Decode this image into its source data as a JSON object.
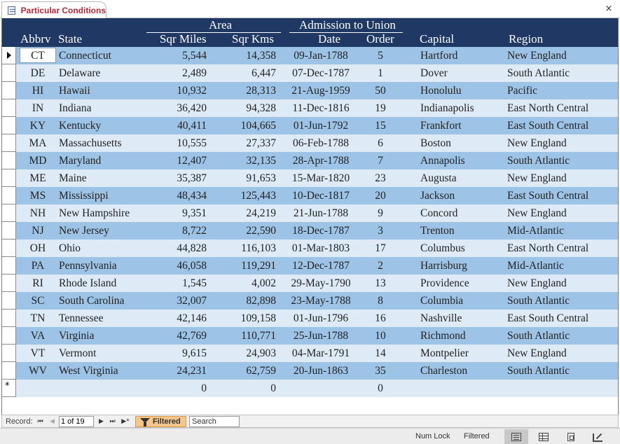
{
  "tab": {
    "title": "Particular Conditions",
    "close_glyph": "×"
  },
  "header": {
    "groups": {
      "area": "Area",
      "admission": "Admission to Union"
    },
    "columns": {
      "abbrv": "Abbrv",
      "state": "State",
      "sqr_miles": "Sqr Miles",
      "sqr_kms": "Sqr Kms",
      "date": "Date",
      "order": "Order",
      "capital": "Capital",
      "region": "Region"
    }
  },
  "records": [
    {
      "abbr": "CT",
      "state": "Connecticut",
      "miles": "5,544",
      "kms": "14,358",
      "date": "09-Jan-1788",
      "order": "5",
      "capital": "Hartford",
      "region": "New England"
    },
    {
      "abbr": "DE",
      "state": "Delaware",
      "miles": "2,489",
      "kms": "6,447",
      "date": "07-Dec-1787",
      "order": "1",
      "capital": "Dover",
      "region": "South Atlantic"
    },
    {
      "abbr": "HI",
      "state": "Hawaii",
      "miles": "10,932",
      "kms": "28,313",
      "date": "21-Aug-1959",
      "order": "50",
      "capital": "Honolulu",
      "region": "Pacific"
    },
    {
      "abbr": "IN",
      "state": "Indiana",
      "miles": "36,420",
      "kms": "94,328",
      "date": "11-Dec-1816",
      "order": "19",
      "capital": "Indianapolis",
      "region": "East North Central"
    },
    {
      "abbr": "KY",
      "state": "Kentucky",
      "miles": "40,411",
      "kms": "104,665",
      "date": "01-Jun-1792",
      "order": "15",
      "capital": "Frankfort",
      "region": "East South Central"
    },
    {
      "abbr": "MA",
      "state": "Massachusetts",
      "miles": "10,555",
      "kms": "27,337",
      "date": "06-Feb-1788",
      "order": "6",
      "capital": "Boston",
      "region": "New England"
    },
    {
      "abbr": "MD",
      "state": "Maryland",
      "miles": "12,407",
      "kms": "32,135",
      "date": "28-Apr-1788",
      "order": "7",
      "capital": "Annapolis",
      "region": "South Atlantic"
    },
    {
      "abbr": "ME",
      "state": "Maine",
      "miles": "35,387",
      "kms": "91,653",
      "date": "15-Mar-1820",
      "order": "23",
      "capital": "Augusta",
      "region": "New England"
    },
    {
      "abbr": "MS",
      "state": "Mississippi",
      "miles": "48,434",
      "kms": "125,443",
      "date": "10-Dec-1817",
      "order": "20",
      "capital": "Jackson",
      "region": "East South Central"
    },
    {
      "abbr": "NH",
      "state": "New Hampshire",
      "miles": "9,351",
      "kms": "24,219",
      "date": "21-Jun-1788",
      "order": "9",
      "capital": "Concord",
      "region": "New England"
    },
    {
      "abbr": "NJ",
      "state": "New Jersey",
      "miles": "8,722",
      "kms": "22,590",
      "date": "18-Dec-1787",
      "order": "3",
      "capital": "Trenton",
      "region": "Mid-Atlantic"
    },
    {
      "abbr": "OH",
      "state": "Ohio",
      "miles": "44,828",
      "kms": "116,103",
      "date": "01-Mar-1803",
      "order": "17",
      "capital": "Columbus",
      "region": "East North Central"
    },
    {
      "abbr": "PA",
      "state": "Pennsylvania",
      "miles": "46,058",
      "kms": "119,291",
      "date": "12-Dec-1787",
      "order": "2",
      "capital": "Harrisburg",
      "region": "Mid-Atlantic"
    },
    {
      "abbr": "RI",
      "state": "Rhode Island",
      "miles": "1,545",
      "kms": "4,002",
      "date": "29-May-1790",
      "order": "13",
      "capital": "Providence",
      "region": "New England"
    },
    {
      "abbr": "SC",
      "state": "South Carolina",
      "miles": "32,007",
      "kms": "82,898",
      "date": "23-May-1788",
      "order": "8",
      "capital": "Columbia",
      "region": "South Atlantic"
    },
    {
      "abbr": "TN",
      "state": "Tennessee",
      "miles": "42,146",
      "kms": "109,158",
      "date": "01-Jun-1796",
      "order": "16",
      "capital": "Nashville",
      "region": "East South Central"
    },
    {
      "abbr": "VA",
      "state": "Virginia",
      "miles": "42,769",
      "kms": "110,771",
      "date": "25-Jun-1788",
      "order": "10",
      "capital": "Richmond",
      "region": "South Atlantic"
    },
    {
      "abbr": "VT",
      "state": "Vermont",
      "miles": "9,615",
      "kms": "24,903",
      "date": "04-Mar-1791",
      "order": "14",
      "capital": "Montpelier",
      "region": "New England"
    },
    {
      "abbr": "WV",
      "state": "West Virginia",
      "miles": "24,231",
      "kms": "62,759",
      "date": "20-Jun-1863",
      "order": "35",
      "capital": "Charleston",
      "region": "South Atlantic"
    }
  ],
  "new_record": {
    "marker": "*",
    "miles": "0",
    "kms": "0",
    "order": "0"
  },
  "navigation": {
    "label": "Record:",
    "current": "1 of 19",
    "first_glyph": "⏮",
    "prev_glyph": "◀",
    "next_glyph": "▶",
    "last_glyph": "⏭",
    "new_glyph": "▶*",
    "filter_status": "Filtered",
    "search_placeholder": "Search"
  },
  "status": {
    "num_lock": "Num Lock",
    "filtered": "Filtered"
  },
  "colors": {
    "header_bg": "#1f3864",
    "row_dark": "#9dc3e6",
    "row_light": "#deebf7",
    "tab_text": "#b2293a",
    "filter_bg": "#f7c68a"
  }
}
